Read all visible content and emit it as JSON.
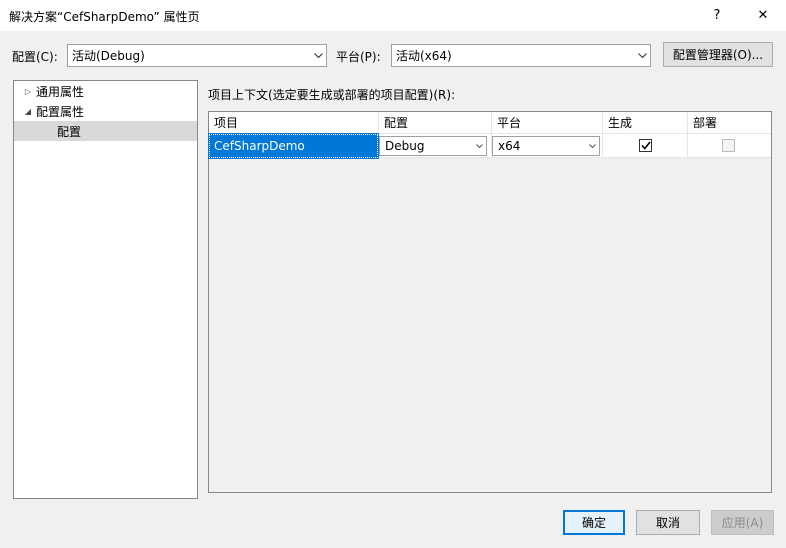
{
  "window": {
    "title": "解决方案“CefSharpDemo” 属性页",
    "help_glyph": "?",
    "close_glyph": "✕"
  },
  "toolbar": {
    "config_label": "配置(C):",
    "config_value": "活动(Debug)",
    "platform_label": "平台(P):",
    "platform_value": "活动(x64)",
    "config_manager_label": "配置管理器(O)..."
  },
  "tree": {
    "items": [
      {
        "label": "通用属性",
        "expander": "▷"
      },
      {
        "label": "配置属性",
        "expander": "◢"
      },
      {
        "label": "配置",
        "expander": ""
      }
    ]
  },
  "main": {
    "context_label": "项目上下文(选定要生成或部署的项目配置)(R):",
    "columns": [
      "项目",
      "配置",
      "平台",
      "生成",
      "部署"
    ],
    "rows": [
      {
        "project": "CefSharpDemo",
        "configuration": "Debug",
        "platform": "x64",
        "build": true,
        "deploy": false
      }
    ]
  },
  "footer": {
    "ok_label": "确定",
    "cancel_label": "取消",
    "apply_label": "应用(A)"
  },
  "colors": {
    "accent": "#0078d7",
    "dialog_bg": "#f0f0f0"
  }
}
